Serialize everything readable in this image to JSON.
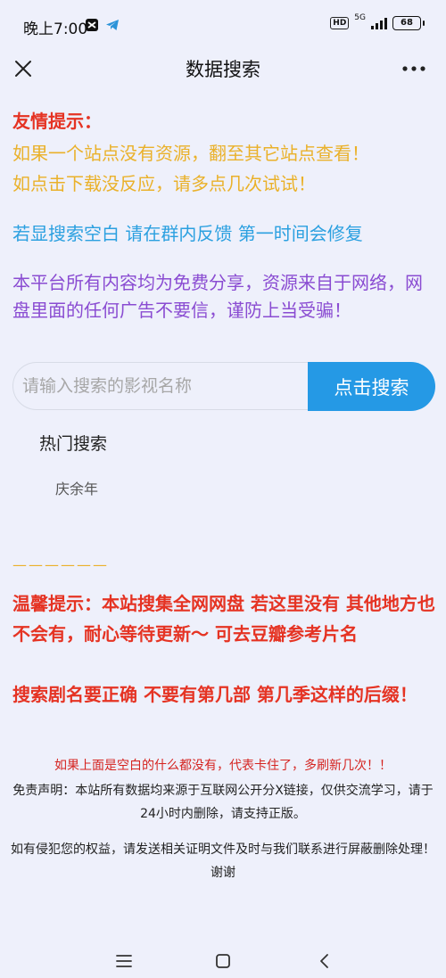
{
  "status_bar": {
    "time": "晚上7:00",
    "hd": "HD",
    "network": "5G",
    "battery": "68"
  },
  "header": {
    "title": "数据搜索"
  },
  "notice": {
    "title": "友情提示：",
    "line1": "如果一个站点没有资源，翻至其它站点查看！",
    "line2": "如点击下载没反应，请多点几次试试！",
    "blue_line": "若显搜索空白 请在群内反馈 第一时间会修复",
    "purple_line": "本平台所有内容均为免费分享，资源来自于网络，网盘里面的任何广告不要信，谨防上当受骗！"
  },
  "search": {
    "placeholder": "请输入搜索的影视名称",
    "button_label": "点击搜索"
  },
  "hot": {
    "title": "热门搜索",
    "items": [
      "庆余年"
    ]
  },
  "footer": {
    "divider": "——————",
    "warm_tip": "温馨提示：本站搜集全网网盘 若这里没有 其他地方也不会有，耐心等待更新～ 可去豆瓣参考片名",
    "search_tip": "搜索剧名要正确 不要有第几部 第几季这样的后缀！",
    "refresh_tip": "如果上面是空白的什么都没有，代表卡住了，多刷新几次！！",
    "disclaimer": "免责声明：本站所有数据均来源于互联网公开分X链接，仅供交流学习，请于24小时内删除，请支持正版。",
    "infringe": "如有侵犯您的权益，请发送相关证明文件及时与我们联系进行屏蔽删除处理！谢谢"
  },
  "colors": {
    "background": "#eef0fb",
    "red": "#e53323",
    "orange": "#eab12a",
    "blue": "#2ba0e0",
    "purple": "#8a4cd2",
    "button": "#2599e5"
  },
  "icons": {
    "close": "close-icon",
    "more": "more-icon",
    "capcut": "capcut-icon",
    "telegram": "telegram-icon",
    "nav_menu": "menu-icon",
    "nav_home": "home-icon",
    "nav_back": "back-icon"
  }
}
